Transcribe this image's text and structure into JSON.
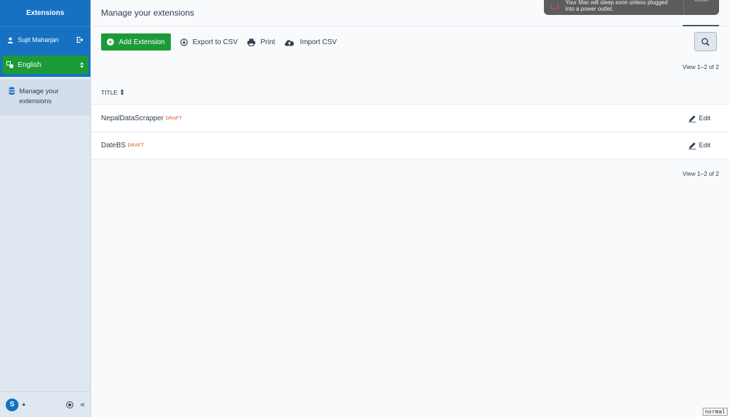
{
  "sidebar": {
    "header": "Extensions",
    "user_name": "Sujit Maharjan",
    "language": "English",
    "nav_items": [
      {
        "label": "Manage your extensions"
      }
    ]
  },
  "topbar": {
    "title": "Manage your extensions"
  },
  "toolbar": {
    "add_label": "Add Extension",
    "export_label": "Export to CSV",
    "print_label": "Print",
    "import_label": "Import CSV"
  },
  "list": {
    "view_count": "View 1–2 of 2",
    "column_title": "TITLE",
    "rows": [
      {
        "title": "NepalDataScrapper",
        "status": "DRAFT",
        "action": "Edit"
      },
      {
        "title": "DateBS",
        "status": "DRAFT",
        "action": "Edit"
      }
    ]
  },
  "notification": {
    "message_line1": "Your Mac will sleep soon unless plugged",
    "message_line2": "into a power outlet.",
    "close_label": "Close"
  },
  "badge": "normal",
  "colors": {
    "primary": "#1671c2",
    "success": "#1c9a38",
    "draft": "#d6480b"
  }
}
